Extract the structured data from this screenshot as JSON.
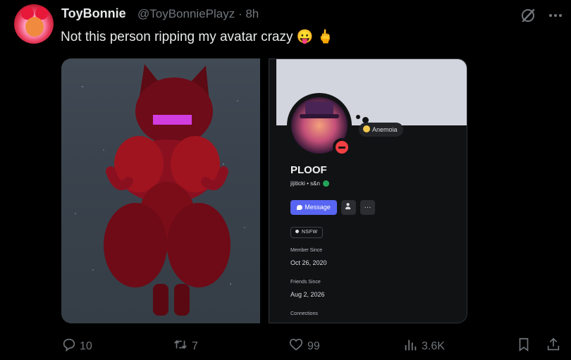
{
  "tweet": {
    "display_name": "ToyBonnie",
    "handle_time": "@ToyBonniePlayz · 8h",
    "text": "Not this person ripping my avatar crazy 😛 🖕"
  },
  "profile_card": {
    "name": "PLOOF",
    "username_line": "jijiticki • s&n",
    "status": "Anemoia",
    "message_label": "Message",
    "more_label": "···",
    "badge": "NSFW",
    "member_since_label": "Member Since",
    "member_since_value": "Oct 26, 2020",
    "friends_since_label": "Friends Since",
    "friends_since_value": "Aug 2, 2026",
    "connections_label": "Connections"
  },
  "actions": {
    "replies": "10",
    "reposts": "7",
    "likes": "99",
    "views": "3.6K"
  },
  "colors": {
    "background": "#000000",
    "text": "#e7e9ea",
    "muted": "#71767b",
    "discord_blurple": "#5865f2",
    "dnd_red": "#f23f43"
  },
  "icons": [
    "grok-icon",
    "more-icon",
    "reply-icon",
    "repost-icon",
    "like-icon",
    "views-icon",
    "bookmark-icon",
    "share-icon"
  ]
}
